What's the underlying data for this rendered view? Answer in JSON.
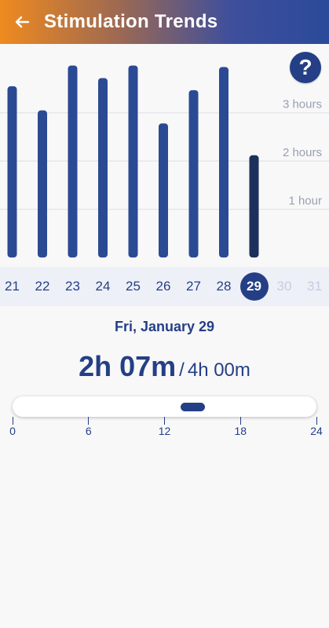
{
  "header": {
    "title": "Stimulation Trends",
    "back_icon": "back-arrow-icon"
  },
  "help": {
    "label": "?"
  },
  "chart_data": {
    "type": "bar",
    "categories": [
      "21",
      "22",
      "23",
      "24",
      "25",
      "26",
      "27",
      "28",
      "29"
    ],
    "values": [
      3.55,
      3.05,
      3.98,
      3.72,
      3.98,
      2.78,
      3.47,
      3.95,
      2.12
    ],
    "selected_index": 8,
    "yticks": [
      {
        "value": 1,
        "label": "1 hour"
      },
      {
        "value": 2,
        "label": "2 hours"
      },
      {
        "value": 3,
        "label": "3 hours"
      }
    ],
    "ylim": [
      0,
      4.2
    ],
    "colors": {
      "bar": "#2b4a94",
      "selected": "#1d2f5c",
      "grid": "#dcdfe6"
    }
  },
  "days": [
    {
      "label": "21",
      "state": "past"
    },
    {
      "label": "22",
      "state": "past"
    },
    {
      "label": "23",
      "state": "past"
    },
    {
      "label": "24",
      "state": "past"
    },
    {
      "label": "25",
      "state": "past"
    },
    {
      "label": "26",
      "state": "past"
    },
    {
      "label": "27",
      "state": "past"
    },
    {
      "label": "28",
      "state": "past"
    },
    {
      "label": "29",
      "state": "selected"
    },
    {
      "label": "30",
      "state": "future"
    },
    {
      "label": "31",
      "state": "future"
    }
  ],
  "summary": {
    "date": "Fri, January 29",
    "total": "2h 07m",
    "separator": "/",
    "goal": "4h 00m"
  },
  "timeline": {
    "ticks": [
      "0",
      "6",
      "12",
      "18",
      "24"
    ],
    "segments": [
      {
        "start_hour": 13.3,
        "end_hour": 15.2
      }
    ]
  }
}
